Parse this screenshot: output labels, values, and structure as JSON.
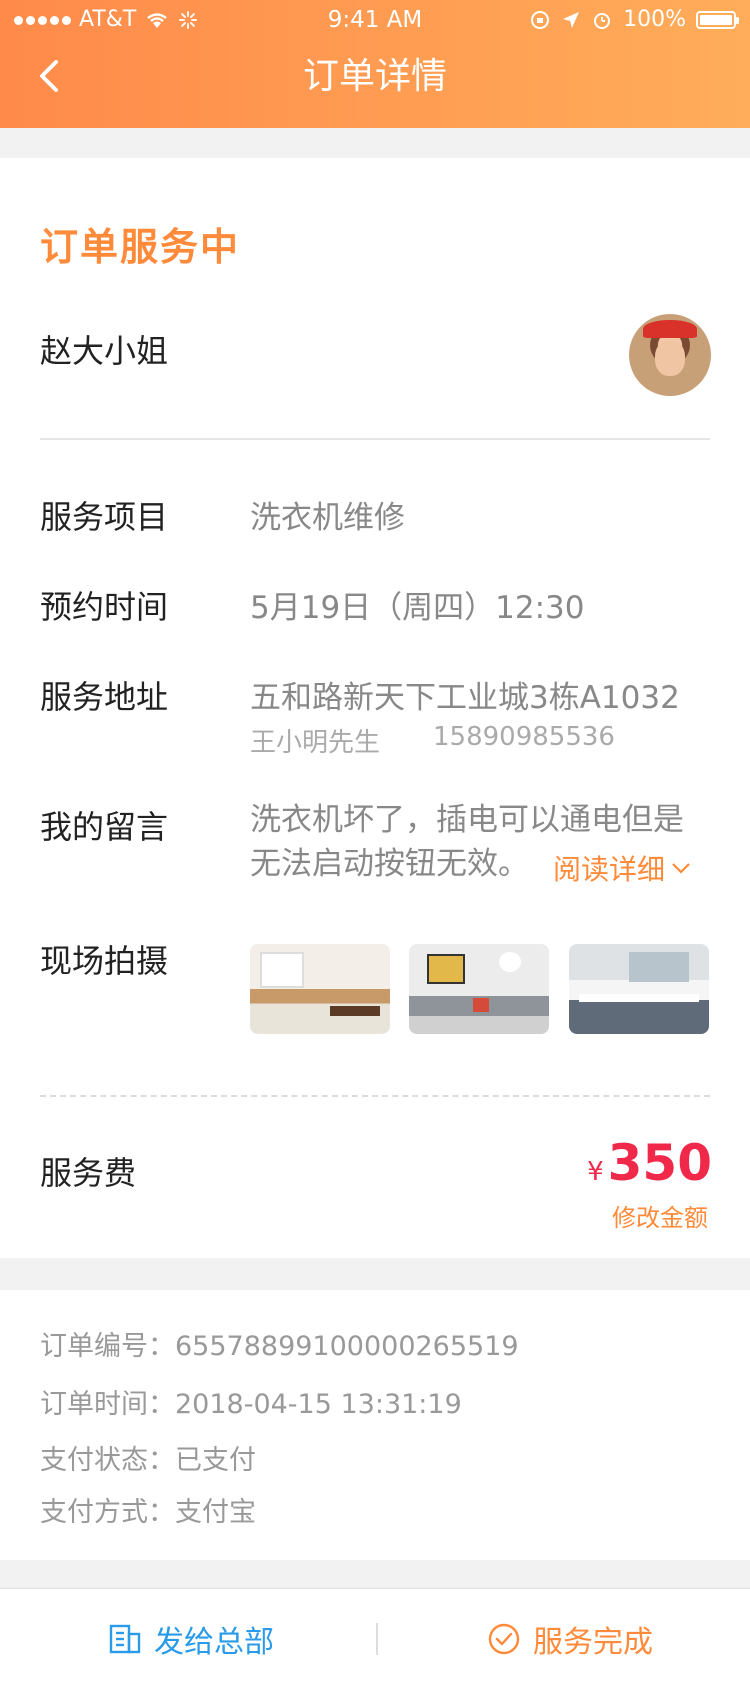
{
  "status_bar": {
    "carrier": "AT&T",
    "time": "9:41 AM",
    "battery": "100%"
  },
  "nav": {
    "title": "订单详情"
  },
  "order_status": "订单服务中",
  "customer": {
    "name": "赵大小姐"
  },
  "details": {
    "service_label": "服务项目",
    "service_value": "洗衣机维修",
    "time_label": "预约时间",
    "time_value": "5月19日（周四）12:30",
    "address_label": "服务地址",
    "address_value": "五和路新天下工业城3栋A1032",
    "contact_name": "王小明先生",
    "contact_phone": "15890985536",
    "message_label": "我的留言",
    "message_value": "洗衣机坏了，插电可以通电但是无法启动按钮无效。",
    "read_more": "阅读详细",
    "photos_label": "现场拍摄"
  },
  "fee": {
    "label": "服务费",
    "currency": "¥",
    "amount": "350",
    "edit": "修改金额"
  },
  "order_info": {
    "number_label": "订单编号：",
    "number_value": "6557889910000026551­9",
    "time_label": "订单时间：",
    "time_value": "2018-04-15  13:31:19",
    "pay_status_label": "支付状态：",
    "pay_status_value": "已支付",
    "pay_method_label": "支付方式：",
    "pay_method_value": "支付宝"
  },
  "bottom": {
    "send_label": "发给总部",
    "done_label": "服务完成"
  },
  "colors": {
    "accent": "#ff8a3a",
    "price": "#f0284a",
    "blue": "#2a9be8"
  }
}
